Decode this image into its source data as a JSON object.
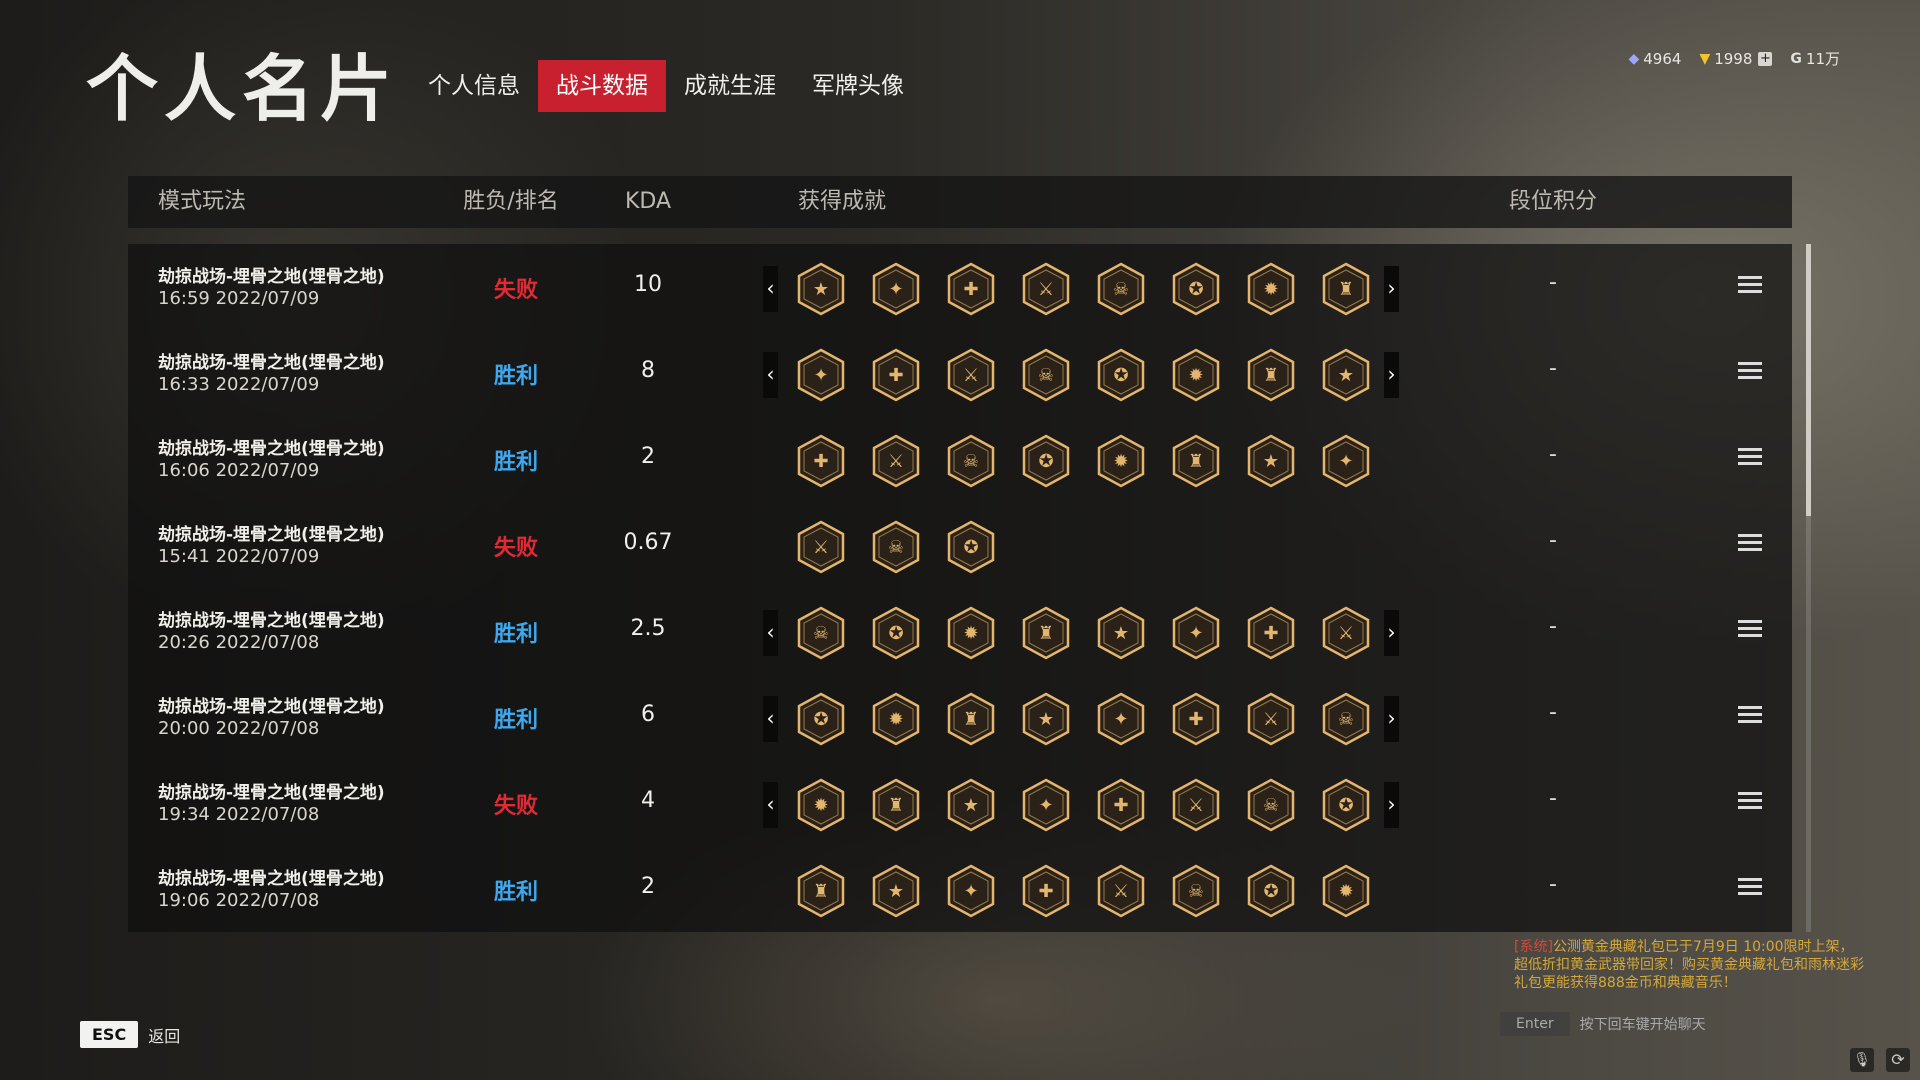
{
  "title": "个人名片",
  "tabs": [
    {
      "label": "个人信息",
      "active": false
    },
    {
      "label": "战斗数据",
      "active": true
    },
    {
      "label": "成就生涯",
      "active": false
    },
    {
      "label": "军牌头像",
      "active": false
    }
  ],
  "currency": [
    {
      "icon": "diamond-icon",
      "value": "4964"
    },
    {
      "icon": "voucher-icon",
      "value": "1998"
    },
    {
      "icon": "coin-icon",
      "value": "11万"
    }
  ],
  "columns": {
    "mode": "模式玩法",
    "result": "胜负/排名",
    "kda": "KDA",
    "achievements": "获得成就",
    "rank": "段位积分"
  },
  "colors": {
    "win": "#3fa7ec",
    "lose": "#e02a35",
    "active_tab": "#c8202e",
    "badge_gold": "#e3b56e"
  },
  "matches": [
    {
      "mode": "劫掠战场-埋骨之地(埋骨之地)",
      "time": "16:59  2022/07/09",
      "result": "失败",
      "outcome": "lose",
      "kda": "10",
      "badge_count": 8,
      "arrows": true,
      "rank": "-"
    },
    {
      "mode": "劫掠战场-埋骨之地(埋骨之地)",
      "time": "16:33  2022/07/09",
      "result": "胜利",
      "outcome": "win",
      "kda": "8",
      "badge_count": 8,
      "arrows": true,
      "rank": "-"
    },
    {
      "mode": "劫掠战场-埋骨之地(埋骨之地)",
      "time": "16:06  2022/07/09",
      "result": "胜利",
      "outcome": "win",
      "kda": "2",
      "badge_count": 8,
      "arrows": false,
      "rank": "-"
    },
    {
      "mode": "劫掠战场-埋骨之地(埋骨之地)",
      "time": "15:41  2022/07/09",
      "result": "失败",
      "outcome": "lose",
      "kda": "0.67",
      "badge_count": 3,
      "arrows": false,
      "rank": "-"
    },
    {
      "mode": "劫掠战场-埋骨之地(埋骨之地)",
      "time": "20:26  2022/07/08",
      "result": "胜利",
      "outcome": "win",
      "kda": "2.5",
      "badge_count": 8,
      "arrows": true,
      "rank": "-"
    },
    {
      "mode": "劫掠战场-埋骨之地(埋骨之地)",
      "time": "20:00  2022/07/08",
      "result": "胜利",
      "outcome": "win",
      "kda": "6",
      "badge_count": 8,
      "arrows": true,
      "rank": "-"
    },
    {
      "mode": "劫掠战场-埋骨之地(埋骨之地)",
      "time": "19:34  2022/07/08",
      "result": "失败",
      "outcome": "lose",
      "kda": "4",
      "badge_count": 8,
      "arrows": true,
      "rank": "-"
    },
    {
      "mode": "劫掠战场-埋骨之地(埋骨之地)",
      "time": "19:06  2022/07/08",
      "result": "胜利",
      "outcome": "win",
      "kda": "2",
      "badge_count": 8,
      "arrows": false,
      "rank": "-"
    }
  ],
  "footer": {
    "esc_key": "ESC",
    "esc_label": "返回"
  },
  "chat": {
    "tag": "[系统]",
    "message": "公测黄金典藏礼包已于7月9日 10:00限时上架，超低折扣黄金武器带回家！购买黄金典藏礼包和雨林迷彩礼包更能获得888金币和典藏音乐！",
    "enter_key": "Enter",
    "enter_hint": "按下回车键开始聊天"
  }
}
